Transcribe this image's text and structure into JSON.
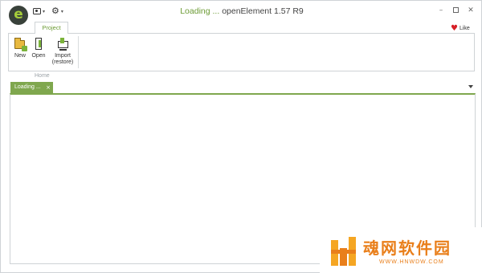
{
  "titlebar": {
    "loading_text": "Loading ...",
    "app_title": "openElement 1.57 R9",
    "logo_letter": "e",
    "quick_access_chevron": "▾",
    "window_controls": {
      "minimize": "–",
      "close": "✕"
    }
  },
  "ribbon": {
    "tabs": [
      {
        "label": "Project",
        "active": true
      }
    ],
    "like_label": "Like",
    "groups": [
      {
        "label": "Home",
        "buttons": [
          {
            "label": "New",
            "icon": "new-project-icon"
          },
          {
            "label": "Open",
            "icon": "open-project-icon"
          },
          {
            "label_line1": "Import",
            "label_line2": "(restore)",
            "icon": "import-restore-icon"
          }
        ]
      }
    ]
  },
  "documents": {
    "tabs": [
      {
        "label": "Loading ...",
        "close": "×"
      }
    ]
  },
  "watermark": {
    "text": "魂网软件园",
    "url": "WWW.HNWDW.COM"
  },
  "colors": {
    "accent_green": "#7fa74e",
    "title_green": "#6c9b35",
    "heart_red": "#d71f26",
    "watermark_orange": "#e97f1b"
  }
}
